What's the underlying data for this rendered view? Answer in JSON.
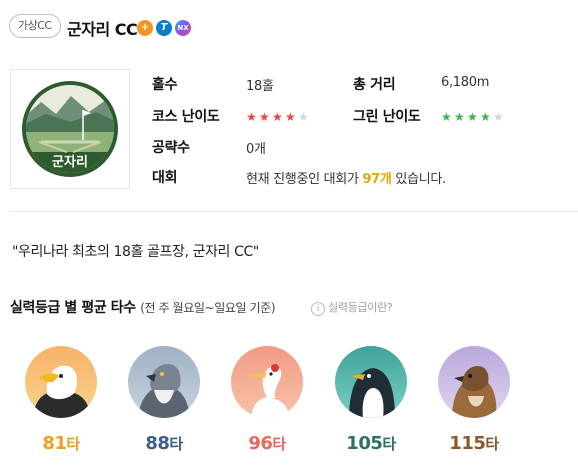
{
  "header": {
    "tag": "가상CC",
    "title": "군자리 CC",
    "badges": [
      "+",
      "T",
      "NX"
    ]
  },
  "logo": {
    "text": "군자리"
  },
  "info": {
    "holes_label": "홀수",
    "holes_value": "18홀",
    "distance_label": "총 거리",
    "distance_value": "6,180m",
    "course_difficulty_label": "코스 난이도",
    "course_difficulty_stars": 4,
    "green_difficulty_label": "그린 난이도",
    "green_difficulty_stars": 4,
    "tips_label": "공략수",
    "tips_value": "0개",
    "tournament_label": "대회",
    "tournament_prefix": "현재 진행중인 대회가 ",
    "tournament_count": "97개",
    "tournament_suffix": " 있습니다."
  },
  "quote": "\"우리나라 최초의 18홀 골프장, 군자리 CC\"",
  "grade_section": {
    "title": "실력등급 별 평균 타수",
    "subtitle": "(전 주 월요일~일요일 기준)",
    "help": "실력등급이란?",
    "grades": [
      {
        "bird": "eagle-icon",
        "score": "81",
        "unit": "타",
        "color": "#f0a020"
      },
      {
        "bird": "hawk-icon",
        "score": "88",
        "unit": "타",
        "color": "#3d5f8a"
      },
      {
        "bird": "crane-icon",
        "score": "96",
        "unit": "타",
        "color": "#e8685a"
      },
      {
        "bird": "penguin-icon",
        "score": "105",
        "unit": "타",
        "color": "#2f6f6a"
      },
      {
        "bird": "sparrow-icon",
        "score": "115",
        "unit": "타",
        "color": "#8a5a2b"
      }
    ]
  }
}
